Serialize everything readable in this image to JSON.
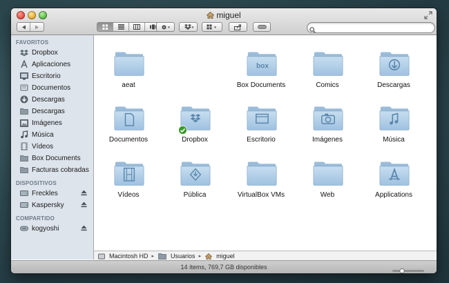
{
  "window": {
    "title": "miguel"
  },
  "search": {
    "placeholder": "",
    "value": ""
  },
  "sidebar": {
    "sections": [
      {
        "heading": "FAVORITOS",
        "items": [
          {
            "label": "Dropbox",
            "icon": "dropbox-icon"
          },
          {
            "label": "Aplicaciones",
            "icon": "applications-icon"
          },
          {
            "label": "Escritorio",
            "icon": "desktop-icon"
          },
          {
            "label": "Documentos",
            "icon": "documents-icon"
          },
          {
            "label": "Descargas",
            "icon": "downloads-icon"
          },
          {
            "label": "Descargas",
            "icon": "folder-icon"
          },
          {
            "label": "Imágenes",
            "icon": "pictures-icon"
          },
          {
            "label": "Música",
            "icon": "music-icon"
          },
          {
            "label": "Vídeos",
            "icon": "movies-icon"
          },
          {
            "label": "Box Documents",
            "icon": "folder-icon"
          },
          {
            "label": "Facturas cobradas",
            "icon": "folder-icon"
          }
        ]
      },
      {
        "heading": "DISPOSITIVOS",
        "items": [
          {
            "label": "Freckles",
            "icon": "drive-icon",
            "eject": true
          },
          {
            "label": "Kaspersky",
            "icon": "drive-icon",
            "eject": true
          }
        ]
      },
      {
        "heading": "COMPARTIDO",
        "items": [
          {
            "label": "kogyoshi",
            "icon": "network-share-icon",
            "eject": true
          }
        ]
      }
    ]
  },
  "files": [
    {
      "label": "aeat",
      "glyph": "none"
    },
    {
      "label": "Box Documents",
      "glyph": "box"
    },
    {
      "label": "Comics",
      "glyph": "none"
    },
    {
      "label": "Descargas",
      "glyph": "download"
    },
    {
      "label": "Documentos",
      "glyph": "document"
    },
    {
      "label": "Dropbox",
      "glyph": "dropbox",
      "badge": true
    },
    {
      "label": "Escritorio",
      "glyph": "desktop"
    },
    {
      "label": "Imágenes",
      "glyph": "camera"
    },
    {
      "label": "Música",
      "glyph": "music"
    },
    {
      "label": "Vídeos",
      "glyph": "film"
    },
    {
      "label": "Pública",
      "glyph": "public"
    },
    {
      "label": "VirtualBox VMs",
      "glyph": "none"
    },
    {
      "label": "Web",
      "glyph": "none"
    },
    {
      "label": "Applications",
      "glyph": "apps"
    }
  ],
  "pathbar": [
    {
      "label": "Macintosh HD",
      "icon": "hard-drive-icon"
    },
    {
      "label": "Usuarios",
      "icon": "folder-icon"
    },
    {
      "label": "miguel",
      "icon": "home-icon"
    }
  ],
  "status": {
    "text": "14 ítems, 769,7 GB disponibles"
  },
  "colors": {
    "folder": "#a9c9e6",
    "sidebar": "#dde4ec",
    "badge": "#3a9a2a"
  }
}
